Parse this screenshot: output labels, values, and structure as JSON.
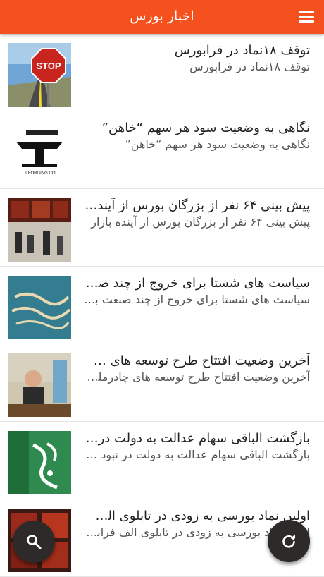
{
  "app_bar": {
    "title": "اخبار بورس",
    "menu_icon": "hamburger-menu-icon",
    "color": "#f4511e"
  },
  "news": [
    {
      "title": "توقف ۱۸نماد در فرابورس",
      "subtitle": "توقف ۱۸نماد در فرابورس",
      "thumbnail": "stop-sign-road-image"
    },
    {
      "title": "نگاهی به وضعیت سود هر سهم “خاهن”",
      "subtitle": "نگاهی به وضعیت سود هر سهم “خاهن”",
      "thumbnail": "forging-company-logo-image",
      "thumbnail_caption": "I.T.FORGING CO."
    },
    {
      "title": "پیش بینی ۶۴ نفر از بزرگان بورس از آینده …",
      "subtitle": "پیش بینی ۶۴ نفر از بزرگان بورس از آینده بازار",
      "thumbnail": "stock-exchange-hall-image"
    },
    {
      "title": "سیاست های شستا برای خروج از چند صن…",
      "subtitle": "سیاست های شستا برای خروج از چند صنعت بور…",
      "thumbnail": "company-sign-image"
    },
    {
      "title": "آخرین وضعیت افتتاح طرح توسعه های …",
      "subtitle": "آخرین وضعیت افتتاح طرح توسعه های چادرملو…",
      "thumbnail": "official-at-desk-image"
    },
    {
      "title": "بازگشت الباقی سهام عدالت به دولت در نب…",
      "subtitle": "بازگشت الباقی سهام عدالت به دولت در نبود تقاضا",
      "thumbnail": "edalat-shares-logo-image"
    },
    {
      "title": "اولین نماد بورسی به زودی در تابلوی الف …",
      "subtitle": "اولین نماد بورسی به زودی در تابلوی الف فرابورس",
      "thumbnail": "ticker-board-image"
    }
  ],
  "fabs": {
    "search_icon": "search-icon",
    "refresh_icon": "refresh-icon"
  }
}
